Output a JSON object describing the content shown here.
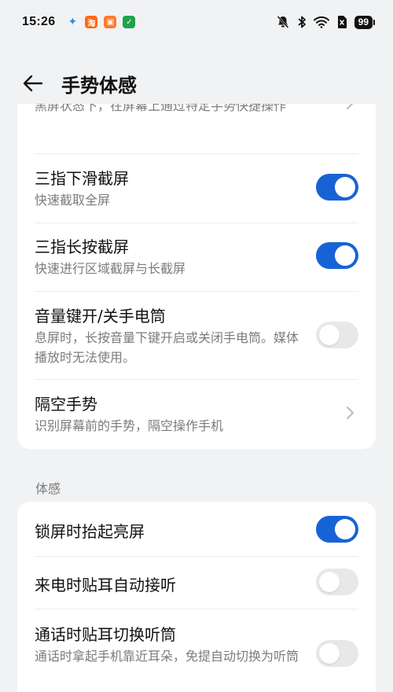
{
  "status_bar": {
    "time": "15:26",
    "app_icons": [
      {
        "name": "bird-app-icon",
        "glyph": "✦",
        "color": "#2c8fdc"
      },
      {
        "name": "taobao-app-icon",
        "glyph": "淘",
        "color": "#ff6a13"
      },
      {
        "name": "orange-app-icon",
        "glyph": "▣",
        "color": "#ff7a2b"
      },
      {
        "name": "shield-app-icon",
        "glyph": "✓",
        "color": "#1ea34a"
      }
    ],
    "battery": "99"
  },
  "header": {
    "title": "手势体感"
  },
  "gestures": {
    "partial_row": {
      "subtitle": "黑屏状态下，在屏幕上通过特定手势快捷操作"
    },
    "three_finger_swipe": {
      "title": "三指下滑截屏",
      "subtitle": "快速截取全屏",
      "enabled": true
    },
    "three_finger_hold": {
      "title": "三指长按截屏",
      "subtitle": "快速进行区域截屏与长截屏",
      "enabled": true
    },
    "volume_flashlight": {
      "title": "音量键开/关手电筒",
      "subtitle": "息屏时，长按音量下键开启或关闭手电筒。媒体播放时无法使用。",
      "enabled": false
    },
    "air_gesture": {
      "title": "隔空手势",
      "subtitle": "识别屏幕前的手势，隔空操作手机"
    }
  },
  "motion": {
    "section_label": "体感",
    "raise_to_wake": {
      "title": "锁屏时抬起亮屏",
      "enabled": true
    },
    "ear_answer": {
      "title": "来电时贴耳自动接听",
      "enabled": false
    },
    "ear_switch": {
      "title": "通话时贴耳切换听筒",
      "subtitle": "通话时拿起手机靠近耳朵，免提自动切换为听筒",
      "enabled": false
    }
  },
  "colors": {
    "accent": "#1763d6",
    "background": "#f1f2f4",
    "card": "#ffffff",
    "secondary_text": "#7b7b7b"
  }
}
